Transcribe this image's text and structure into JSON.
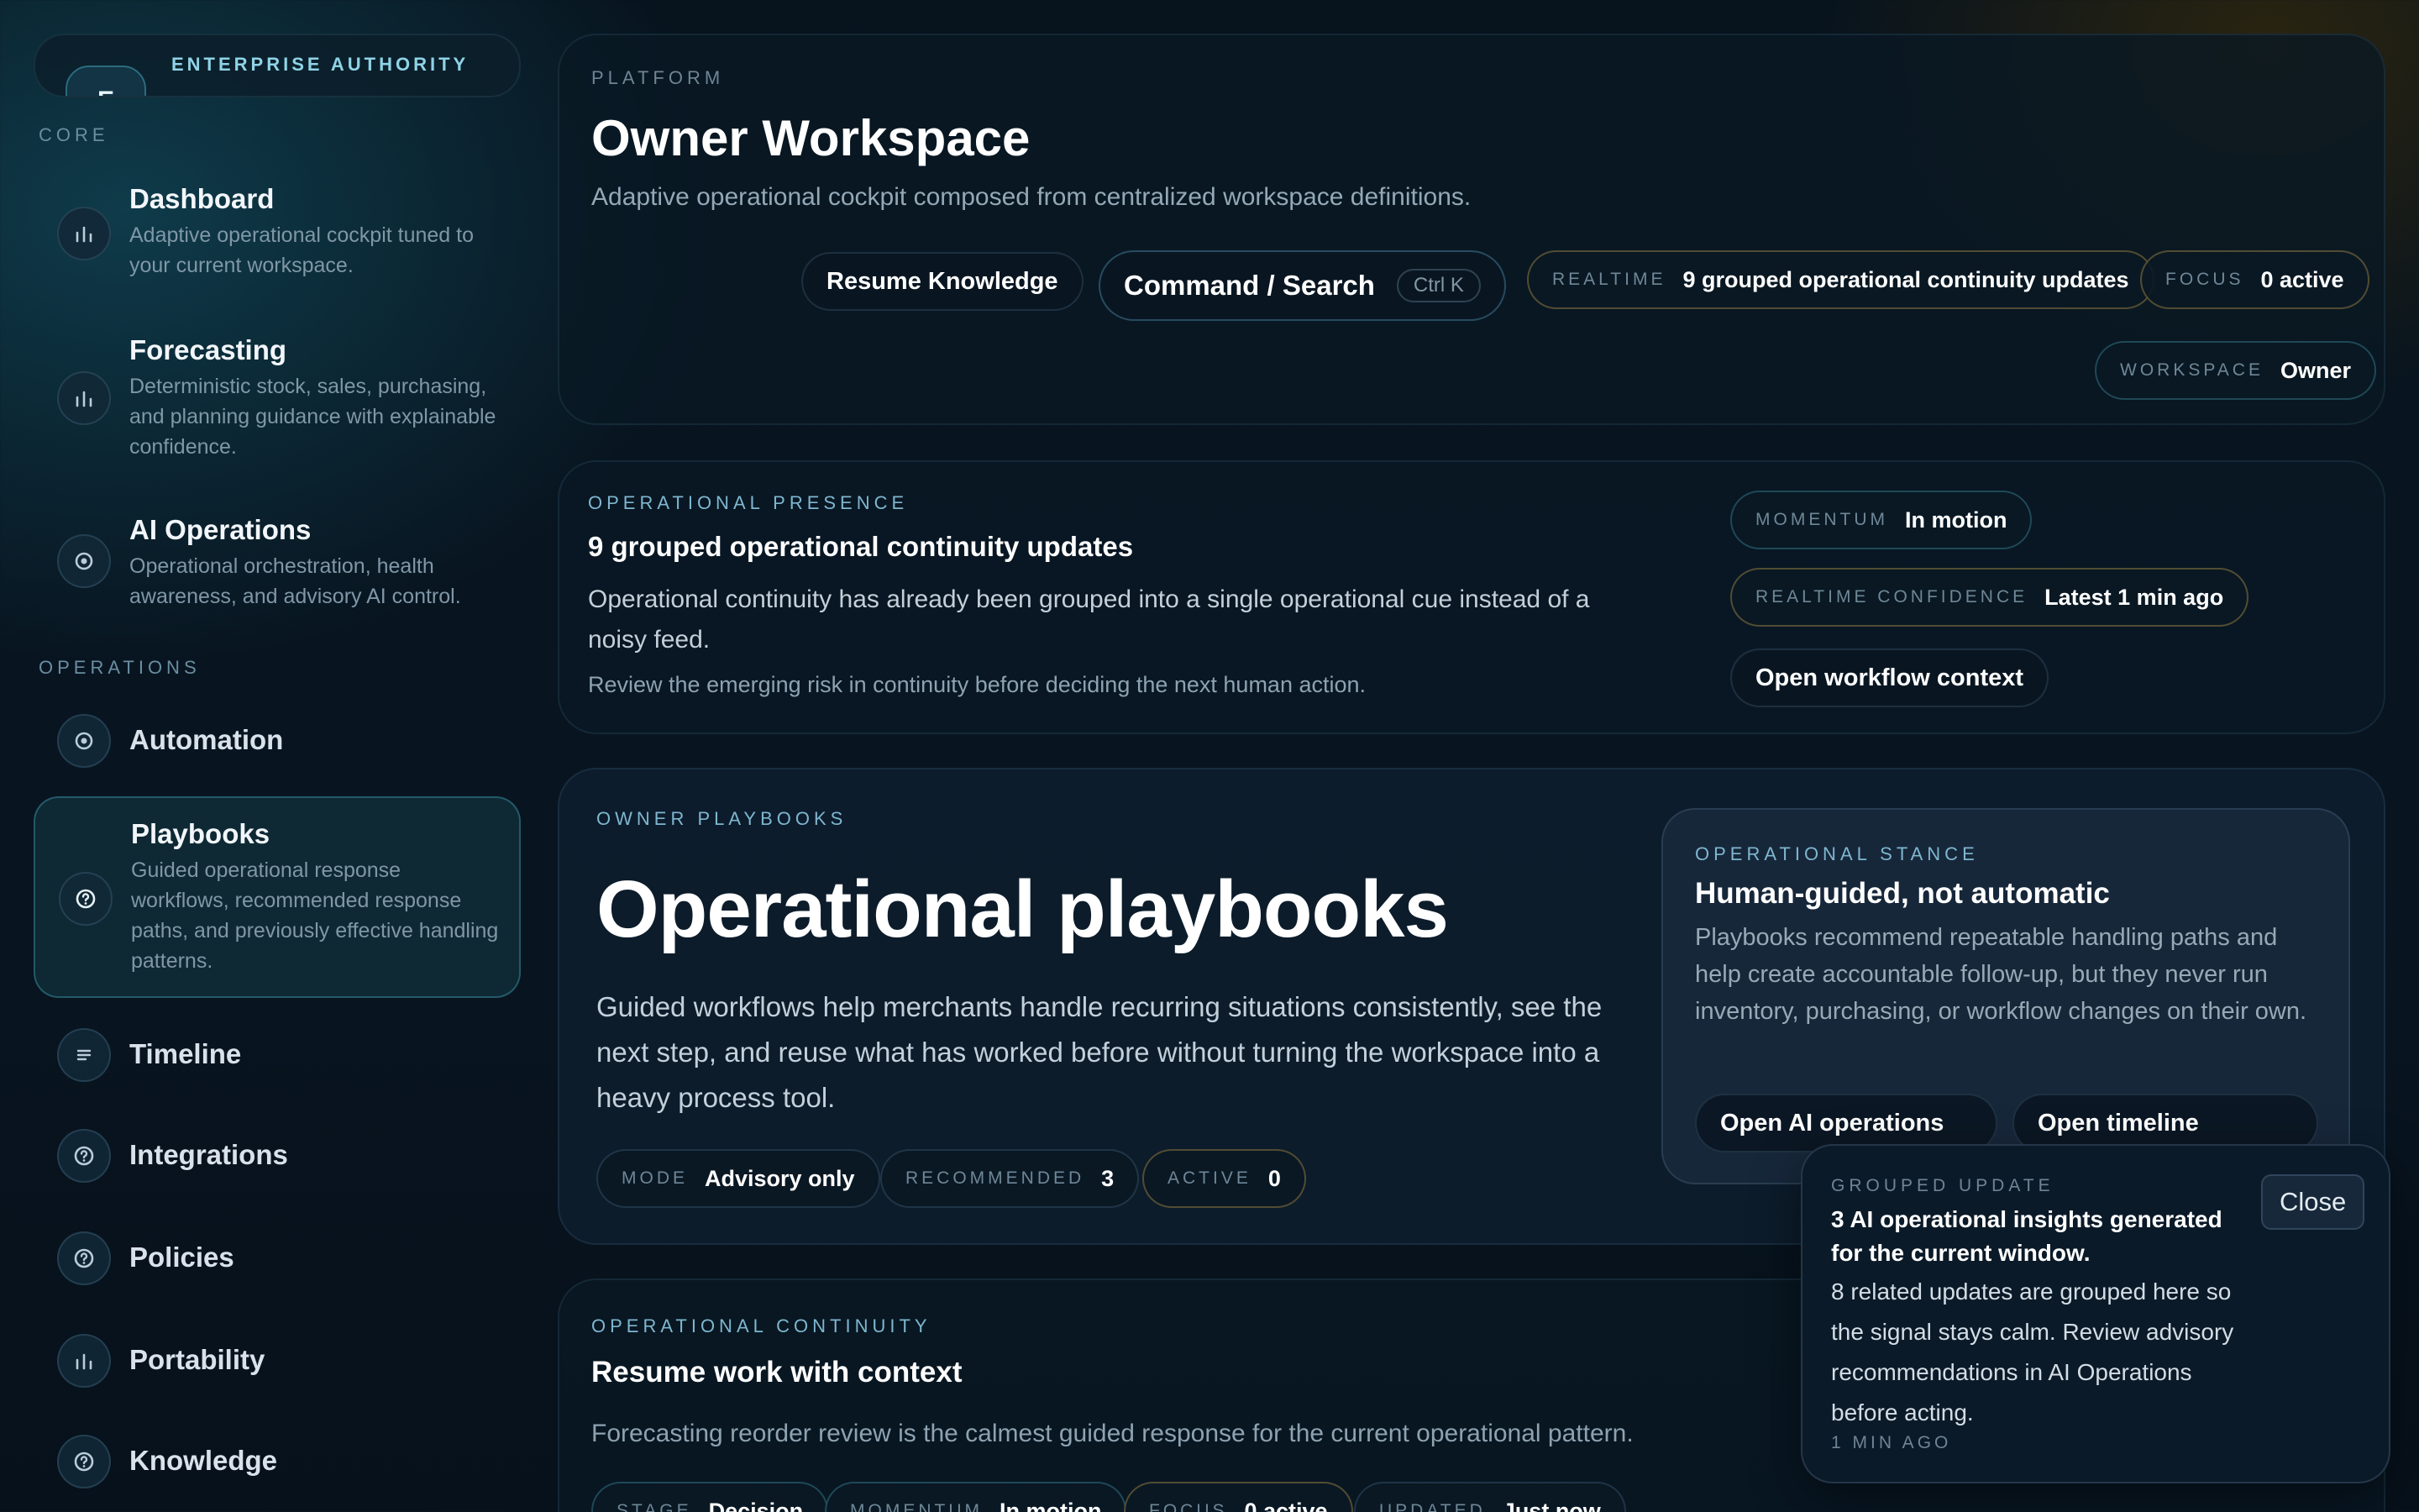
{
  "sidebar": {
    "brand": {
      "logo": "E",
      "label": "ENTERPRISE AUTHORITY"
    },
    "core_label": "CORE",
    "operations_label": "OPERATIONS",
    "core_items": [
      {
        "title": "Dashboard",
        "desc": "Adaptive operational cockpit tuned to your current workspace.",
        "icon": "bar-chart-icon"
      },
      {
        "title": "Forecasting",
        "desc": "Deterministic stock, sales, purchasing, and planning guidance with explainable confidence.",
        "icon": "bar-chart-icon"
      },
      {
        "title": "AI Operations",
        "desc": "Operational orchestration, health awareness, and advisory AI control.",
        "icon": "target-icon"
      }
    ],
    "operations_items": [
      {
        "title": "Automation",
        "icon": "target-icon"
      },
      {
        "title": "Playbooks",
        "desc": "Guided operational response workflows, recommended response paths, and previously effective handling patterns.",
        "icon": "help-icon",
        "active": true
      },
      {
        "title": "Timeline",
        "icon": "list-icon"
      },
      {
        "title": "Integrations",
        "icon": "help-icon"
      },
      {
        "title": "Policies",
        "icon": "help-icon"
      },
      {
        "title": "Portability",
        "icon": "bar-chart-icon"
      },
      {
        "title": "Knowledge",
        "icon": "help-icon"
      }
    ]
  },
  "header": {
    "eyebrow": "PLATFORM",
    "title": "Owner Workspace",
    "subtitle": "Adaptive operational cockpit composed from centralized workspace definitions.",
    "resume_button": "Resume Knowledge",
    "command_button": "Command / Search",
    "command_shortcut": "Ctrl K",
    "realtime_key": "REALTIME",
    "realtime_value": "9 grouped operational continuity updates",
    "focus_key": "FOCUS",
    "focus_value": "0 active",
    "workspace_key": "WORKSPACE",
    "workspace_value": "Owner"
  },
  "presence": {
    "eyebrow": "OPERATIONAL PRESENCE",
    "title": "9 grouped operational continuity updates",
    "body": "Operational continuity has already been grouped into a single operational cue instead of a noisy feed.",
    "note": "Review the emerging risk in continuity before deciding the next human action.",
    "momentum_key": "MOMENTUM",
    "momentum_value": "In motion",
    "confidence_key": "REALTIME CONFIDENCE",
    "confidence_value": "Latest 1 min ago",
    "workflow_button": "Open workflow context"
  },
  "playbooks": {
    "eyebrow": "OWNER PLAYBOOKS",
    "title": "Operational playbooks",
    "body": "Guided workflows help merchants handle recurring situations consistently, see the next step, and reuse what has worked before without turning the workspace into a heavy process tool.",
    "mode_key": "MODE",
    "mode_value": "Advisory only",
    "recommended_key": "RECOMMENDED",
    "recommended_value": "3",
    "active_key": "ACTIVE",
    "active_value": "0",
    "stance": {
      "eyebrow": "OPERATIONAL STANCE",
      "title": "Human-guided, not automatic",
      "body": "Playbooks recommend repeatable handling paths and help create accountable follow-up, but they never run inventory, purchasing, or workflow changes on their own.",
      "ai_button": "Open AI operations",
      "timeline_button": "Open timeline"
    }
  },
  "continuity": {
    "eyebrow": "OPERATIONAL CONTINUITY",
    "title": "Resume work with context",
    "body": "Forecasting reorder review is the calmest guided response for the current operational pattern.",
    "stage_key": "STAGE",
    "stage_value": "Decision",
    "momentum_key": "MOMENTUM",
    "momentum_value": "In motion",
    "focus_key": "FOCUS",
    "focus_value": "0 active",
    "updated_key": "UPDATED",
    "updated_value": "Just now"
  },
  "toast": {
    "eyebrow": "GROUPED UPDATE",
    "title": "3 AI operational insights generated for the current window.",
    "body": "8 related updates are grouped here so the signal stays calm. Review advisory recommendations in AI Operations before acting.",
    "time": "1 MIN AGO",
    "close": "Close"
  }
}
